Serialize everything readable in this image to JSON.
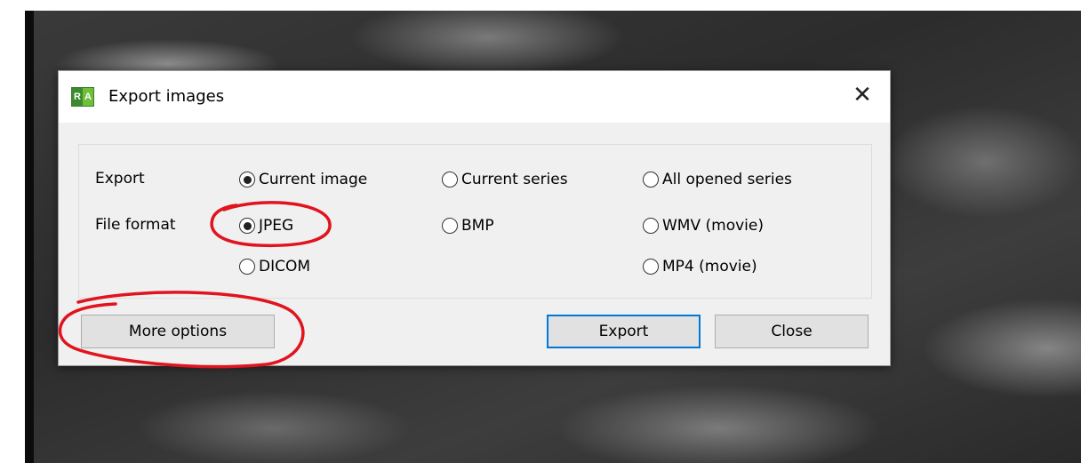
{
  "dialog": {
    "title": "Export images",
    "app_icon": {
      "left": "R",
      "right": "A"
    },
    "close_glyph": "✕"
  },
  "export_row": {
    "label": "Export",
    "options": [
      {
        "label": "Current image",
        "selected": true
      },
      {
        "label": "Current series",
        "selected": false
      },
      {
        "label": "All opened series",
        "selected": false
      }
    ]
  },
  "format_row": {
    "label": "File format",
    "options": [
      {
        "label": "JPEG",
        "selected": true
      },
      {
        "label": "BMP",
        "selected": false
      },
      {
        "label": "WMV (movie)",
        "selected": false
      },
      {
        "label": "DICOM",
        "selected": false
      },
      {
        "label": "MP4 (movie)",
        "selected": false
      }
    ]
  },
  "buttons": {
    "more_options": "More options",
    "export": "Export",
    "close": "Close"
  },
  "colors": {
    "annotation": "#e0141e",
    "default_button_border": "#0078d7"
  }
}
